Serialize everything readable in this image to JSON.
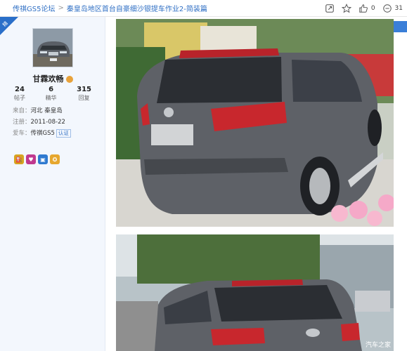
{
  "breadcrumb": {
    "forum": "传祺GS5论坛",
    "separator": ">",
    "title": "秦皇岛地区首台自豪细沙银提车作业2-简装篇"
  },
  "actions": {
    "like_count": "0",
    "comment_count": "31"
  },
  "user": {
    "badge": "精",
    "name": "甘霖欢畅",
    "stats": [
      {
        "num": "24",
        "label": "帖子"
      },
      {
        "num": "6",
        "label": "精华"
      },
      {
        "num": "315",
        "label": "回复"
      }
    ],
    "from_label": "来自：",
    "from_value": "河北 秦皇岛",
    "reg_label": "注册：",
    "reg_value": "2011-08-22",
    "car_label": "爱车：",
    "car_value": "传祺GS5",
    "cert": "认证"
  },
  "photos": {
    "watermark": "汽车之家"
  },
  "colors": {
    "link": "#2f6fc4",
    "sidebar_bg": "#f3f7fd",
    "badge": "#2a6fc9"
  }
}
